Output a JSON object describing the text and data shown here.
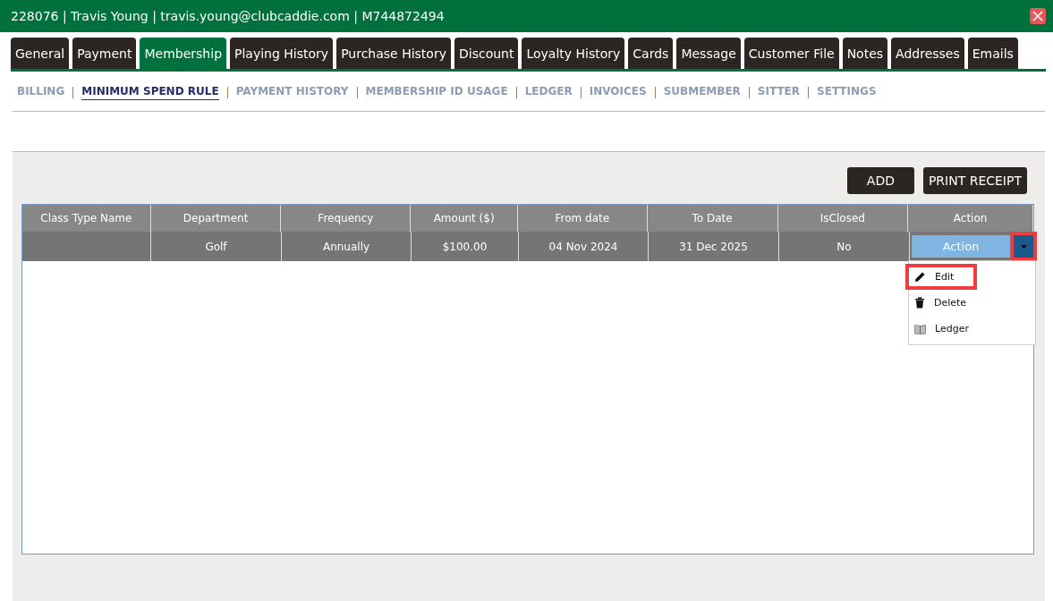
{
  "window": {
    "title": "228076 | Travis Young | travis.young@clubcaddie.com | M744872494"
  },
  "tabs": [
    {
      "label": "General",
      "selected": false
    },
    {
      "label": "Payment",
      "selected": false
    },
    {
      "label": "Membership",
      "selected": true
    },
    {
      "label": "Playing History",
      "selected": false
    },
    {
      "label": "Purchase History",
      "selected": false
    },
    {
      "label": "Discount",
      "selected": false
    },
    {
      "label": "Loyalty History",
      "selected": false
    },
    {
      "label": "Cards",
      "selected": false
    },
    {
      "label": "Message",
      "selected": false
    },
    {
      "label": "Customer File",
      "selected": false
    },
    {
      "label": "Notes",
      "selected": false
    },
    {
      "label": "Addresses",
      "selected": false
    },
    {
      "label": "Emails",
      "selected": false
    }
  ],
  "subnav": [
    {
      "label": "BILLING",
      "selected": false
    },
    {
      "label": "MINIMUM SPEND RULE",
      "selected": true
    },
    {
      "label": "PAYMENT HISTORY",
      "selected": false
    },
    {
      "label": "MEMBERSHIP ID USAGE",
      "selected": false
    },
    {
      "label": "LEDGER",
      "selected": false
    },
    {
      "label": "INVOICES",
      "selected": false
    },
    {
      "label": "SUBMEMBER",
      "selected": false
    },
    {
      "label": "SITTER",
      "selected": false
    },
    {
      "label": "SETTINGS",
      "selected": false
    }
  ],
  "buttons": [
    "ADD",
    "PRINT RECEIPT"
  ],
  "table": {
    "columns": [
      "Class Type Name",
      "Department",
      "Frequency",
      "Amount ($)",
      "From date",
      "To Date",
      "IsClosed",
      "Action"
    ],
    "rows": [
      {
        "cells": [
          "",
          "Golf",
          "Annually",
          "$100.00",
          "04 Nov 2024",
          "31 Dec 2025",
          "No"
        ],
        "action": "Action",
        "toggle_highlighted": true
      }
    ]
  },
  "action_menu": [
    {
      "label": "Edit",
      "kind": "edit",
      "highlighted": true
    },
    {
      "label": "Delete",
      "kind": "delete",
      "highlighted": false
    },
    {
      "label": "Ledger",
      "kind": "ledger",
      "highlighted": false
    }
  ]
}
